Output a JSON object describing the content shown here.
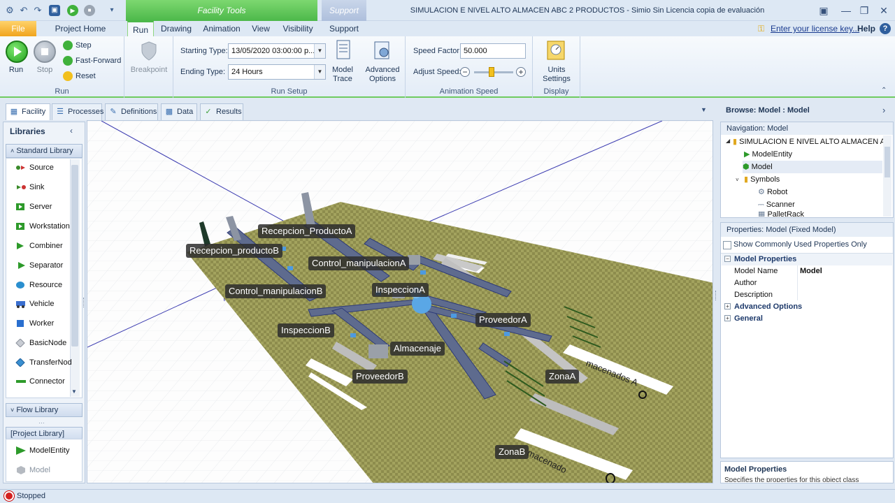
{
  "window": {
    "title": "SIMULACION E NIVEL ALTO ALMACEN ABC 2 PRODUCTOS - Simio Sin Licencia copia de evaluación",
    "context_tab": "Facility Tools",
    "support_context_tab": "Support"
  },
  "tabs": {
    "file": "File",
    "project_home": "Project Home",
    "run": "Run",
    "drawing": "Drawing",
    "animation": "Animation",
    "view": "View",
    "visibility": "Visibility",
    "support": "Support"
  },
  "license": {
    "link": "Enter your license key...",
    "help": "Help"
  },
  "ribbon": {
    "run_group": {
      "title": "Run",
      "run": "Run",
      "stop": "Stop",
      "step": "Step",
      "fast_forward": "Fast-Forward",
      "reset": "Reset"
    },
    "breakpoint": "Breakpoint",
    "run_setup": {
      "title": "Run Setup",
      "starting_type_label": "Starting Type:",
      "starting_type_value": "13/05/2020 03:00:00 p...",
      "ending_type_label": "Ending Type:",
      "ending_type_value": "24 Hours",
      "model_trace": "Model Trace",
      "advanced_options": "Advanced Options"
    },
    "animation_speed": {
      "title": "Animation Speed",
      "speed_factor_label": "Speed Factor:",
      "speed_factor_value": "50.000",
      "adjust_speed_label": "Adjust Speed:"
    },
    "display": {
      "title": "Display",
      "units_settings": "Units Settings"
    }
  },
  "facility_tabs": [
    "Facility",
    "Processes",
    "Definitions",
    "Data",
    "Results"
  ],
  "libraries": {
    "title": "Libraries",
    "standard_library": "Standard Library",
    "items": [
      "Source",
      "Sink",
      "Server",
      "Workstation",
      "Combiner",
      "Separator",
      "Resource",
      "Vehicle",
      "Worker",
      "BasicNode",
      "TransferNod",
      "Connector"
    ],
    "flow_library": "Flow Library",
    "project_library": "[Project Library]",
    "project_items": [
      "ModelEntity",
      "Model"
    ]
  },
  "canvas_labels": {
    "recepcion_a": "Recepcion_ProductoA",
    "recepcion_b": "Recepcion_productoB",
    "control_a": "Control_manipulacionA",
    "control_b": "Control_manipulacionB",
    "inspeccion_a": "InspeccionA",
    "inspeccion_b": "InspeccionB",
    "proveedor_a": "ProveedorA",
    "proveedor_b": "ProveedorB",
    "almacenaje": "Almacenaje",
    "zona_a": "ZonaA",
    "zona_b": "ZonaB",
    "floor_text_a": "macenados A",
    "floor_text_b": "macenado"
  },
  "browse": {
    "title": "Browse: Model : Model"
  },
  "navigation": {
    "title": "Navigation: Model",
    "items": [
      "SIMULACION E NIVEL ALTO ALMACEN A...",
      "ModelEntity",
      "Model",
      "Symbols",
      "Robot",
      "Scanner",
      "PalletRack"
    ]
  },
  "properties": {
    "title": "Properties: Model (Fixed Model)",
    "show_common": "Show Commonly Used Properties Only",
    "model_properties": "Model Properties",
    "model_name_key": "Model Name",
    "model_name_value": "Model",
    "author_key": "Author",
    "description_key": "Description",
    "advanced_options": "Advanced Options",
    "general": "General"
  },
  "description_panel": {
    "title": "Model Properties",
    "text": "Specifies the properties for this object class"
  },
  "status": {
    "text": "Stopped"
  },
  "colors": {
    "accent_green": "#4cb84a",
    "file_orange": "#f0a51d",
    "floor": "#9b9b5a",
    "conveyor": "#5a6a8a"
  }
}
